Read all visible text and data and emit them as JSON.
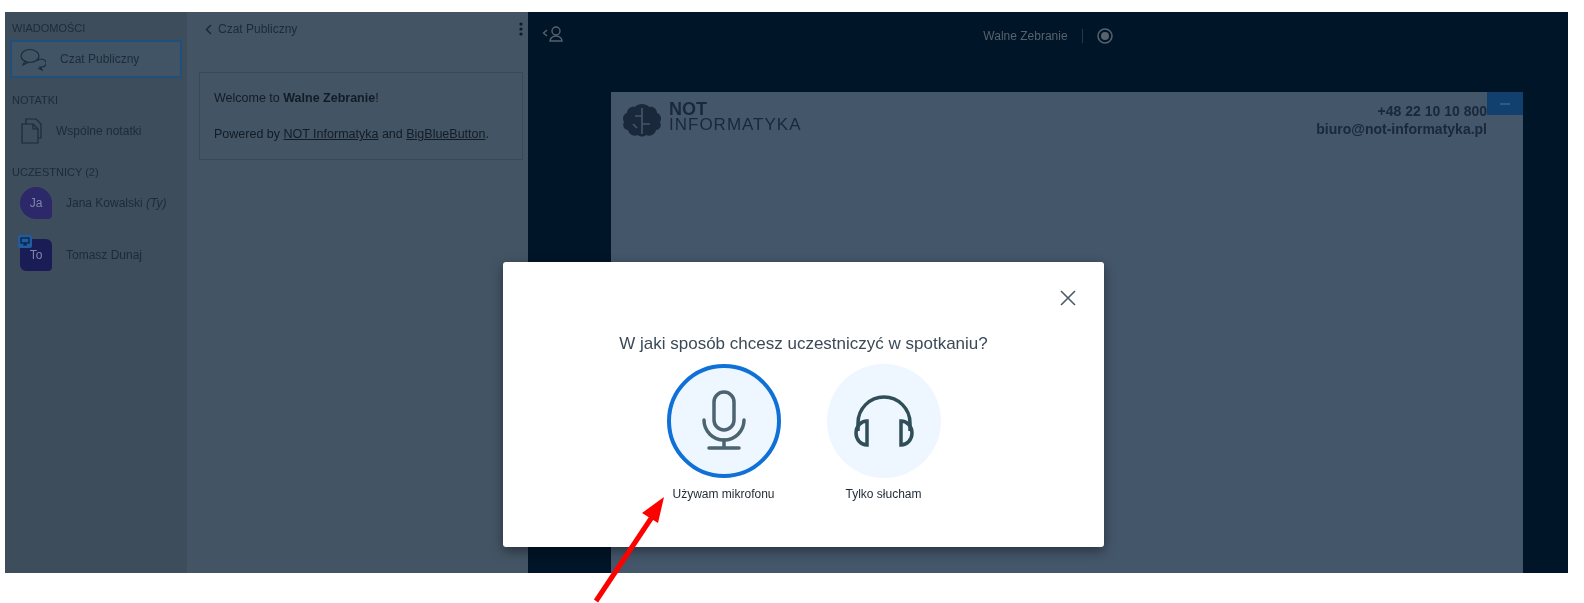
{
  "sidebar": {
    "sections": [
      {
        "heading": "WIADOMOŚCI",
        "items": [
          {
            "kind": "chat",
            "label": "Czat Publiczny",
            "selected": true
          }
        ]
      },
      {
        "heading": "NOTATKI",
        "items": [
          {
            "kind": "notes",
            "label": "Wspólne notatki",
            "selected": false
          }
        ]
      },
      {
        "heading": "UCZESTNICY (2)",
        "items": [
          {
            "kind": "user",
            "initials": "Ja",
            "label": "Jana Kowalski",
            "suffix": "(Ty)",
            "presenter": false,
            "selected": false
          },
          {
            "kind": "user",
            "initials": "To",
            "label": "Tomasz Dunaj",
            "presenter": true,
            "selected": false
          }
        ]
      }
    ]
  },
  "chat": {
    "title": "Czat Publiczny",
    "welcome": "Welcome to **Walne Zebranie**!",
    "powered": [
      {
        "text": "Powered by ",
        "link": false
      },
      {
        "text": "NOT Informatyka",
        "link": true
      },
      {
        "text": " and ",
        "link": false
      },
      {
        "text": "BigBlueButton",
        "link": true
      },
      {
        "text": ".",
        "link": false
      }
    ]
  },
  "presentation": {
    "title": "Walne Zebranie",
    "recording": false,
    "slide": {
      "logo_top": "NOT",
      "logo_bottom": "INFORMATYKA",
      "phone": "+48 22 10 10 800",
      "email": "biuro@not-informatyka.pl"
    }
  },
  "dialog": {
    "question": "W jaki sposób chcesz uczestniczyć w spotkaniu?",
    "options": [
      {
        "kind": "microphone",
        "label": "Używam mikrofonu",
        "selected": true
      },
      {
        "kind": "headphones",
        "label": "Tylko słucham",
        "selected": false
      }
    ]
  }
}
